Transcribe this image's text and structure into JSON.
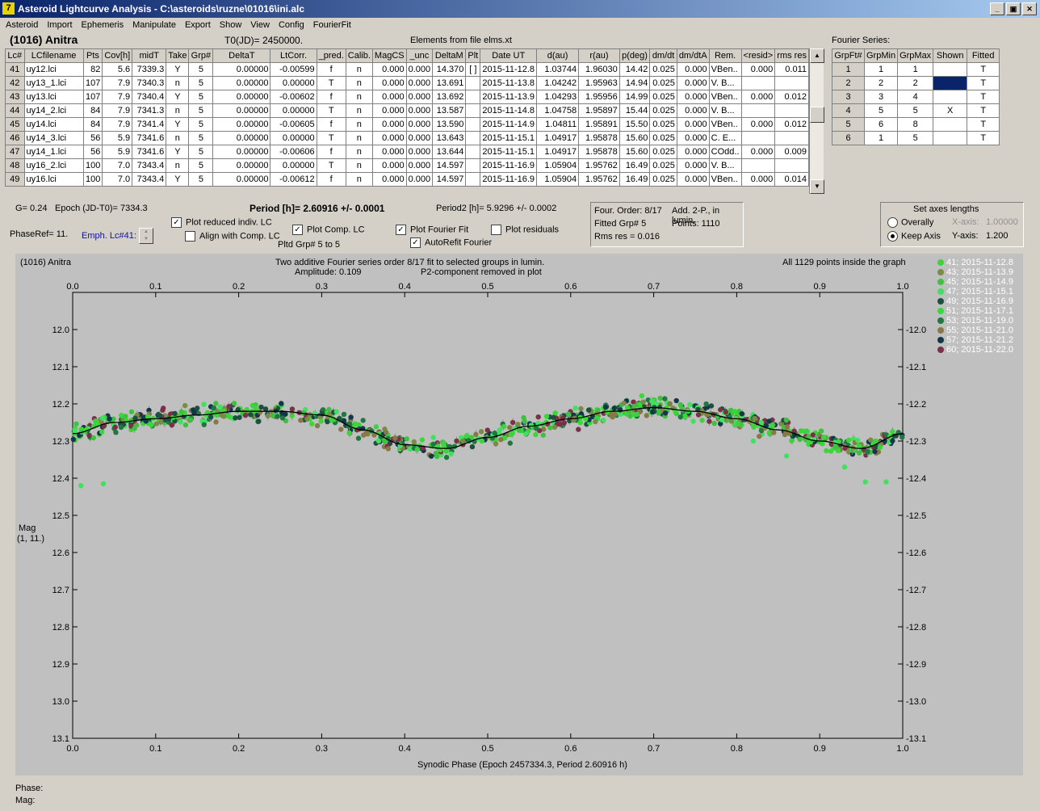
{
  "window": {
    "title": "Asteroid Lightcurve Analysis - C:\\asteroids\\ruzne\\01016\\ini.alc"
  },
  "menu": [
    "Asteroid",
    "Import",
    "Ephemeris",
    "Manipulate",
    "Export",
    "Show",
    "View",
    "Config",
    "FourierFit"
  ],
  "header": {
    "asteroid": "(1016) Anitra",
    "t0": "T0(JD)= 2450000.",
    "elements": "Elements from file elms.xt",
    "fourier_label": "Fourier Series:"
  },
  "lc_table": {
    "columns": [
      "Lc#",
      "LCfilename",
      "Pts",
      "Cov[h]",
      "midT",
      "Take",
      "Grp#",
      "DeltaT",
      "LtCorr.",
      "_pred.",
      "Calib.",
      "MagCS",
      "_unc",
      "DeltaM",
      "Plt",
      "Date UT",
      "d(au)",
      "r(au)",
      "p(deg)",
      "dm/dt",
      "dm/dtA",
      "Rem.",
      "<resid>",
      "rms res"
    ],
    "rows": [
      [
        "41",
        "uy12.lci",
        "82",
        "5.6",
        "7339.3",
        "Y",
        "5",
        "0.00000",
        "-0.00599",
        "f",
        "n",
        "0.000",
        "0.000",
        "14.370",
        "[ ]",
        "2015-11-12.8",
        "1.03744",
        "1.96030",
        "14.42",
        "0.025",
        "0.000",
        "VBen..",
        "0.000",
        "0.011"
      ],
      [
        "42",
        "uy13_1.lci",
        "107",
        "7.9",
        "7340.3",
        "n",
        "5",
        "0.00000",
        "0.00000",
        "T",
        "n",
        "0.000",
        "0.000",
        "13.691",
        "",
        "2015-11-13.8",
        "1.04242",
        "1.95963",
        "14.94",
        "0.025",
        "0.000",
        "V. B...",
        "",
        ""
      ],
      [
        "43",
        "uy13.lci",
        "107",
        "7.9",
        "7340.4",
        "Y",
        "5",
        "0.00000",
        "-0.00602",
        "f",
        "n",
        "0.000",
        "0.000",
        "13.692",
        "",
        "2015-11-13.9",
        "1.04293",
        "1.95956",
        "14.99",
        "0.025",
        "0.000",
        "VBen..",
        "0.000",
        "0.012"
      ],
      [
        "44",
        "uy14_2.lci",
        "84",
        "7.9",
        "7341.3",
        "n",
        "5",
        "0.00000",
        "0.00000",
        "T",
        "n",
        "0.000",
        "0.000",
        "13.587",
        "",
        "2015-11-14.8",
        "1.04758",
        "1.95897",
        "15.44",
        "0.025",
        "0.000",
        "V. B...",
        "",
        ""
      ],
      [
        "45",
        "uy14.lci",
        "84",
        "7.9",
        "7341.4",
        "Y",
        "5",
        "0.00000",
        "-0.00605",
        "f",
        "n",
        "0.000",
        "0.000",
        "13.590",
        "",
        "2015-11-14.9",
        "1.04811",
        "1.95891",
        "15.50",
        "0.025",
        "0.000",
        "VBen..",
        "0.000",
        "0.012"
      ],
      [
        "46",
        "uy14_3.lci",
        "56",
        "5.9",
        "7341.6",
        "n",
        "5",
        "0.00000",
        "0.00000",
        "T",
        "n",
        "0.000",
        "0.000",
        "13.643",
        "",
        "2015-11-15.1",
        "1.04917",
        "1.95878",
        "15.60",
        "0.025",
        "0.000",
        "C. E...",
        "",
        ""
      ],
      [
        "47",
        "uy14_1.lci",
        "56",
        "5.9",
        "7341.6",
        "Y",
        "5",
        "0.00000",
        "-0.00606",
        "f",
        "n",
        "0.000",
        "0.000",
        "13.644",
        "",
        "2015-11-15.1",
        "1.04917",
        "1.95878",
        "15.60",
        "0.025",
        "0.000",
        "COdd..",
        "0.000",
        "0.009"
      ],
      [
        "48",
        "uy16_2.lci",
        "100",
        "7.0",
        "7343.4",
        "n",
        "5",
        "0.00000",
        "0.00000",
        "T",
        "n",
        "0.000",
        "0.000",
        "14.597",
        "",
        "2015-11-16.9",
        "1.05904",
        "1.95762",
        "16.49",
        "0.025",
        "0.000",
        "V. B...",
        "",
        ""
      ],
      [
        "49",
        "uy16.lci",
        "100",
        "7.0",
        "7343.4",
        "Y",
        "5",
        "0.00000",
        "-0.00612",
        "f",
        "n",
        "0.000",
        "0.000",
        "14.597",
        "",
        "2015-11-16.9",
        "1.05904",
        "1.95762",
        "16.49",
        "0.025",
        "0.000",
        "VBen..",
        "0.000",
        "0.014"
      ]
    ]
  },
  "fourier_table": {
    "columns": [
      "GrpFt#",
      "GrpMin",
      "GrpMax",
      "Shown",
      "Fitted"
    ],
    "rows": [
      [
        "1",
        "1",
        "1",
        "",
        "T"
      ],
      [
        "2",
        "2",
        "2",
        "",
        "T"
      ],
      [
        "3",
        "3",
        "4",
        "",
        "T"
      ],
      [
        "4",
        "5",
        "5",
        "X",
        "T"
      ],
      [
        "5",
        "6",
        "8",
        "",
        "T"
      ],
      [
        "6",
        "1",
        "5",
        "",
        "T"
      ]
    ]
  },
  "controls": {
    "g": "G= 0.24",
    "epoch": "Epoch (JD-T0)= 7334.3",
    "period": "Period [h]= 2.60916 +/- 0.0001",
    "period2": "Period2 [h]= 5.9296 +/- 0.0002",
    "phaseref": "PhaseRef= 11.",
    "emph": "Emph. Lc#41:",
    "plot_reduced": "Plot reduced indiv. LC",
    "align_comp": "Align with Comp. LC",
    "plot_comp": "Plot Comp. LC",
    "pltd_grp": "Pltd Grp#  5  to  5",
    "plot_fourier": "Plot Fourier Fit",
    "autorefit": "AutoRefit Fourier",
    "plot_residuals": "Plot residuals",
    "info_order": "Four. Order:  8/17",
    "info_add": "Add. 2-P., in lumin.",
    "info_fitted": "Fitted Grp# 5",
    "info_points": "Points: 1110",
    "info_rms": "Rms res     = 0.016",
    "axes_title": "Set axes lengths",
    "overally": "Overally",
    "keep_axis": "Keep Axis",
    "x_axis_label": "X-axis:",
    "x_axis_value": "1.00000",
    "y_axis_label": "Y-axis:",
    "y_axis_value": "1.200"
  },
  "footer": {
    "phase": "Phase:",
    "mag": "Mag:"
  },
  "colors": {
    "fourier_selected": "#0a246a"
  },
  "chart_data": {
    "type": "scatter",
    "title_left": "(1016) Anitra",
    "title_center": "Two additive Fourier series order 8/17 fit to selected groups in lumin.",
    "amplitude": "Amplitude: 0.109",
    "p2_note": "P2-component removed in plot",
    "title_right": "All 1129 points inside the graph",
    "ylabel": "Mag",
    "ylabel_sub": "(1, 11.)",
    "xlabel": "Synodic Phase (Epoch 2457334.3, Period 2.60916 h)",
    "xlim": [
      0.0,
      1.0
    ],
    "ylim": [
      13.1,
      11.9
    ],
    "xticks": [
      "0.0",
      "0.1",
      "0.2",
      "0.3",
      "0.4",
      "0.5",
      "0.6",
      "0.7",
      "0.8",
      "0.9",
      "1.0"
    ],
    "yticks": [
      "12.0",
      "12.1",
      "12.2",
      "12.3",
      "12.4",
      "12.5",
      "12.6",
      "12.7",
      "12.8",
      "12.9",
      "13.0",
      "13.1"
    ],
    "fit_curve": {
      "x": [
        0.0,
        0.05,
        0.1,
        0.15,
        0.2,
        0.25,
        0.3,
        0.35,
        0.4,
        0.45,
        0.5,
        0.55,
        0.6,
        0.65,
        0.7,
        0.75,
        0.8,
        0.85,
        0.9,
        0.95,
        1.0
      ],
      "y": [
        12.28,
        12.25,
        12.24,
        12.23,
        12.22,
        12.22,
        12.23,
        12.27,
        12.31,
        12.32,
        12.29,
        12.26,
        12.24,
        12.22,
        12.21,
        12.22,
        12.24,
        12.27,
        12.3,
        12.32,
        12.28
      ]
    },
    "series": [
      {
        "name": "41; 2015-11-12.8",
        "color": "#40d040"
      },
      {
        "name": "43; 2015-11-13.9",
        "color": "#7a8a48"
      },
      {
        "name": "45; 2015-11-14.9",
        "color": "#40c040"
      },
      {
        "name": "47; 2015-11-15.1",
        "color": "#40e060"
      },
      {
        "name": "49; 2015-11-16.9",
        "color": "#1c5040"
      },
      {
        "name": "51; 2015-11-17.1",
        "color": "#38d838"
      },
      {
        "name": "53; 2015-11-19.0",
        "color": "#207840"
      },
      {
        "name": "55; 2015-11-21.0",
        "color": "#887848"
      },
      {
        "name": "57; 2015-11-21.2",
        "color": "#103848"
      },
      {
        "name": "60; 2015-11-22.0",
        "color": "#7a3048"
      }
    ]
  }
}
